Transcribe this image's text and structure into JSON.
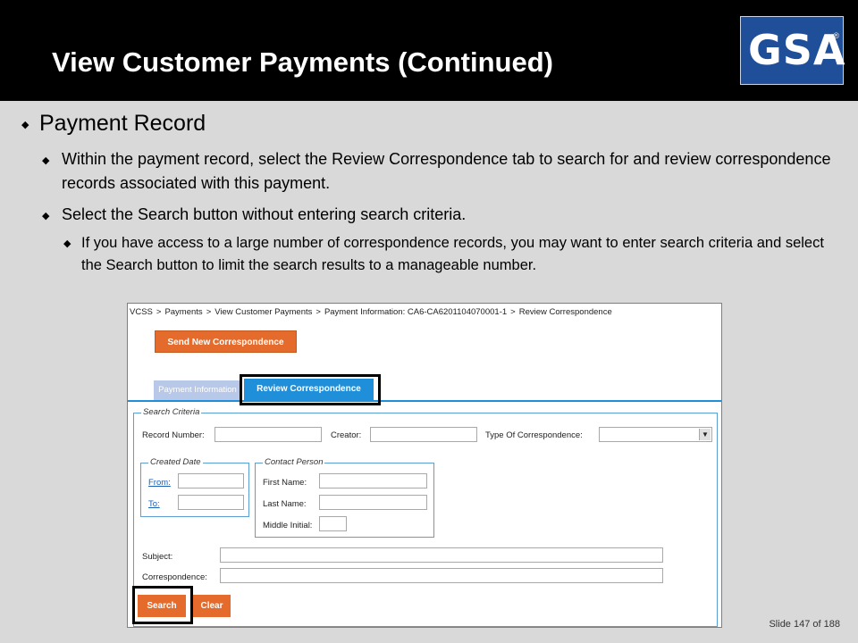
{
  "slide": {
    "title": "View Customer Payments (Continued)",
    "logo_text": "GSA",
    "logo_reg": "®",
    "bullet_glyph": "◆",
    "bullets": {
      "l1": "Payment Record",
      "l2a": "Within the payment record, select the Review Correspondence tab to search for and review correspondence records associated with this payment.",
      "l2b": "Select the Search button without entering search criteria.",
      "l3a": "If you have access to a large number of correspondence records, you may want to enter search criteria and select the Search button to limit the search results to a manageable number."
    },
    "footer": {
      "slide_label": "Slide 147",
      "of_label": "of 188"
    }
  },
  "app": {
    "breadcrumb": [
      "VCSS",
      ">",
      "Payments",
      ">",
      "View Customer Payments",
      ">",
      "Payment Information: CA6-CA6201104070001-1",
      ">",
      "Review Correspondence"
    ],
    "send_button": "Send New Correspondence",
    "tabs": {
      "inactive": "Payment Information",
      "active": "Review Correspondence"
    },
    "criteria": {
      "legend": "Search Criteria",
      "record_number": "Record Number:",
      "creator": "Creator:",
      "type": "Type Of Correspondence:",
      "created_date_legend": "Created Date",
      "from": "From:",
      "to": "To:",
      "contact_legend": "Contact Person",
      "first_name": "First Name:",
      "last_name": "Last Name:",
      "middle_initial": "Middle Initial:",
      "subject": "Subject:",
      "correspondence": "Correspondence:"
    },
    "search_button": "Search",
    "clear_button": "Clear",
    "colors": {
      "accent_orange": "#e46b2b",
      "tab_blue": "#1e8fd8",
      "logo_blue": "#1f4f99"
    }
  }
}
